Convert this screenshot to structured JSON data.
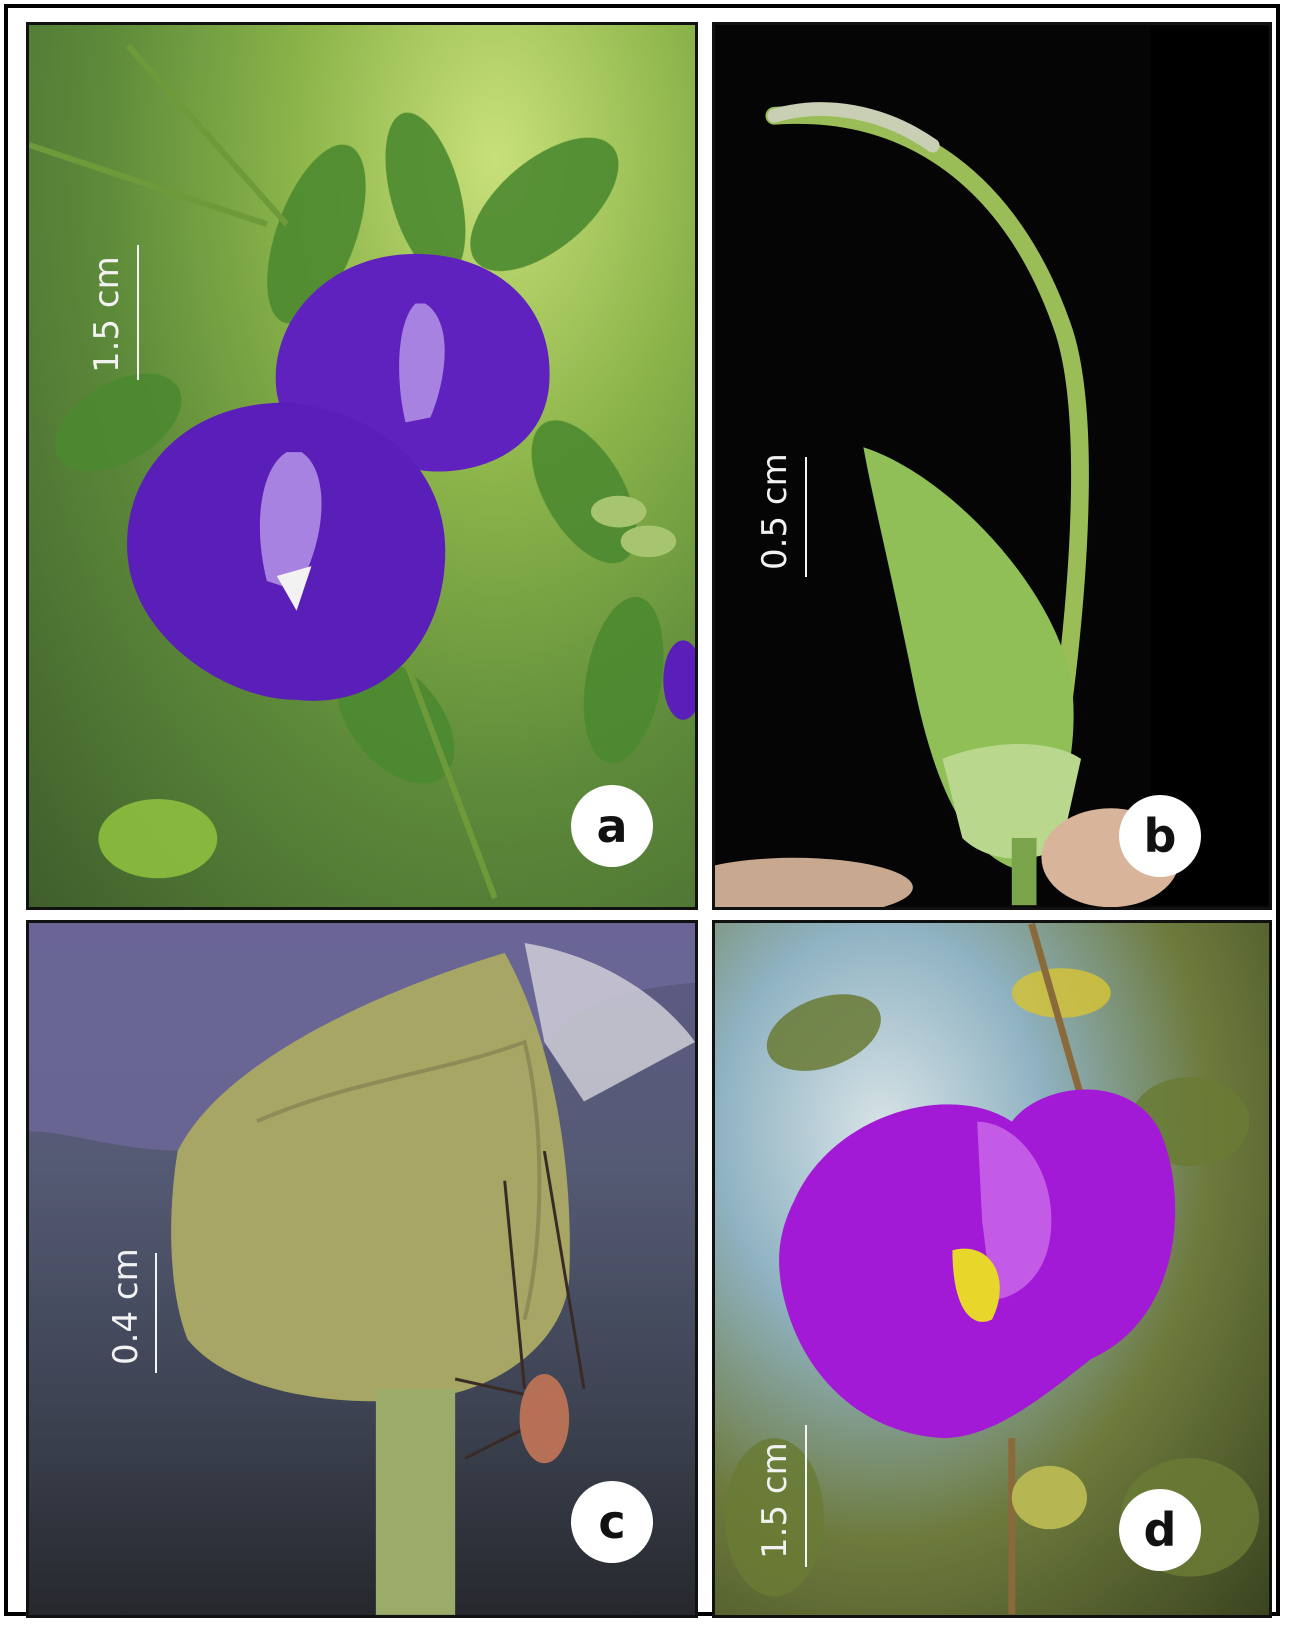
{
  "panels": [
    {
      "id": "a",
      "label": "a",
      "scale": "1.5 cm"
    },
    {
      "id": "b",
      "label": "b",
      "scale": "0.5 cm"
    },
    {
      "id": "c",
      "label": "c",
      "scale": "0.4 cm"
    },
    {
      "id": "d",
      "label": "d",
      "scale": "1.5 cm"
    }
  ],
  "colors": {
    "flower_a": "#5a1fb8",
    "flower_d": "#a21ad6",
    "leaf": "#4f8a2f",
    "calyx": "#8ea35a",
    "frame": "#000000"
  }
}
